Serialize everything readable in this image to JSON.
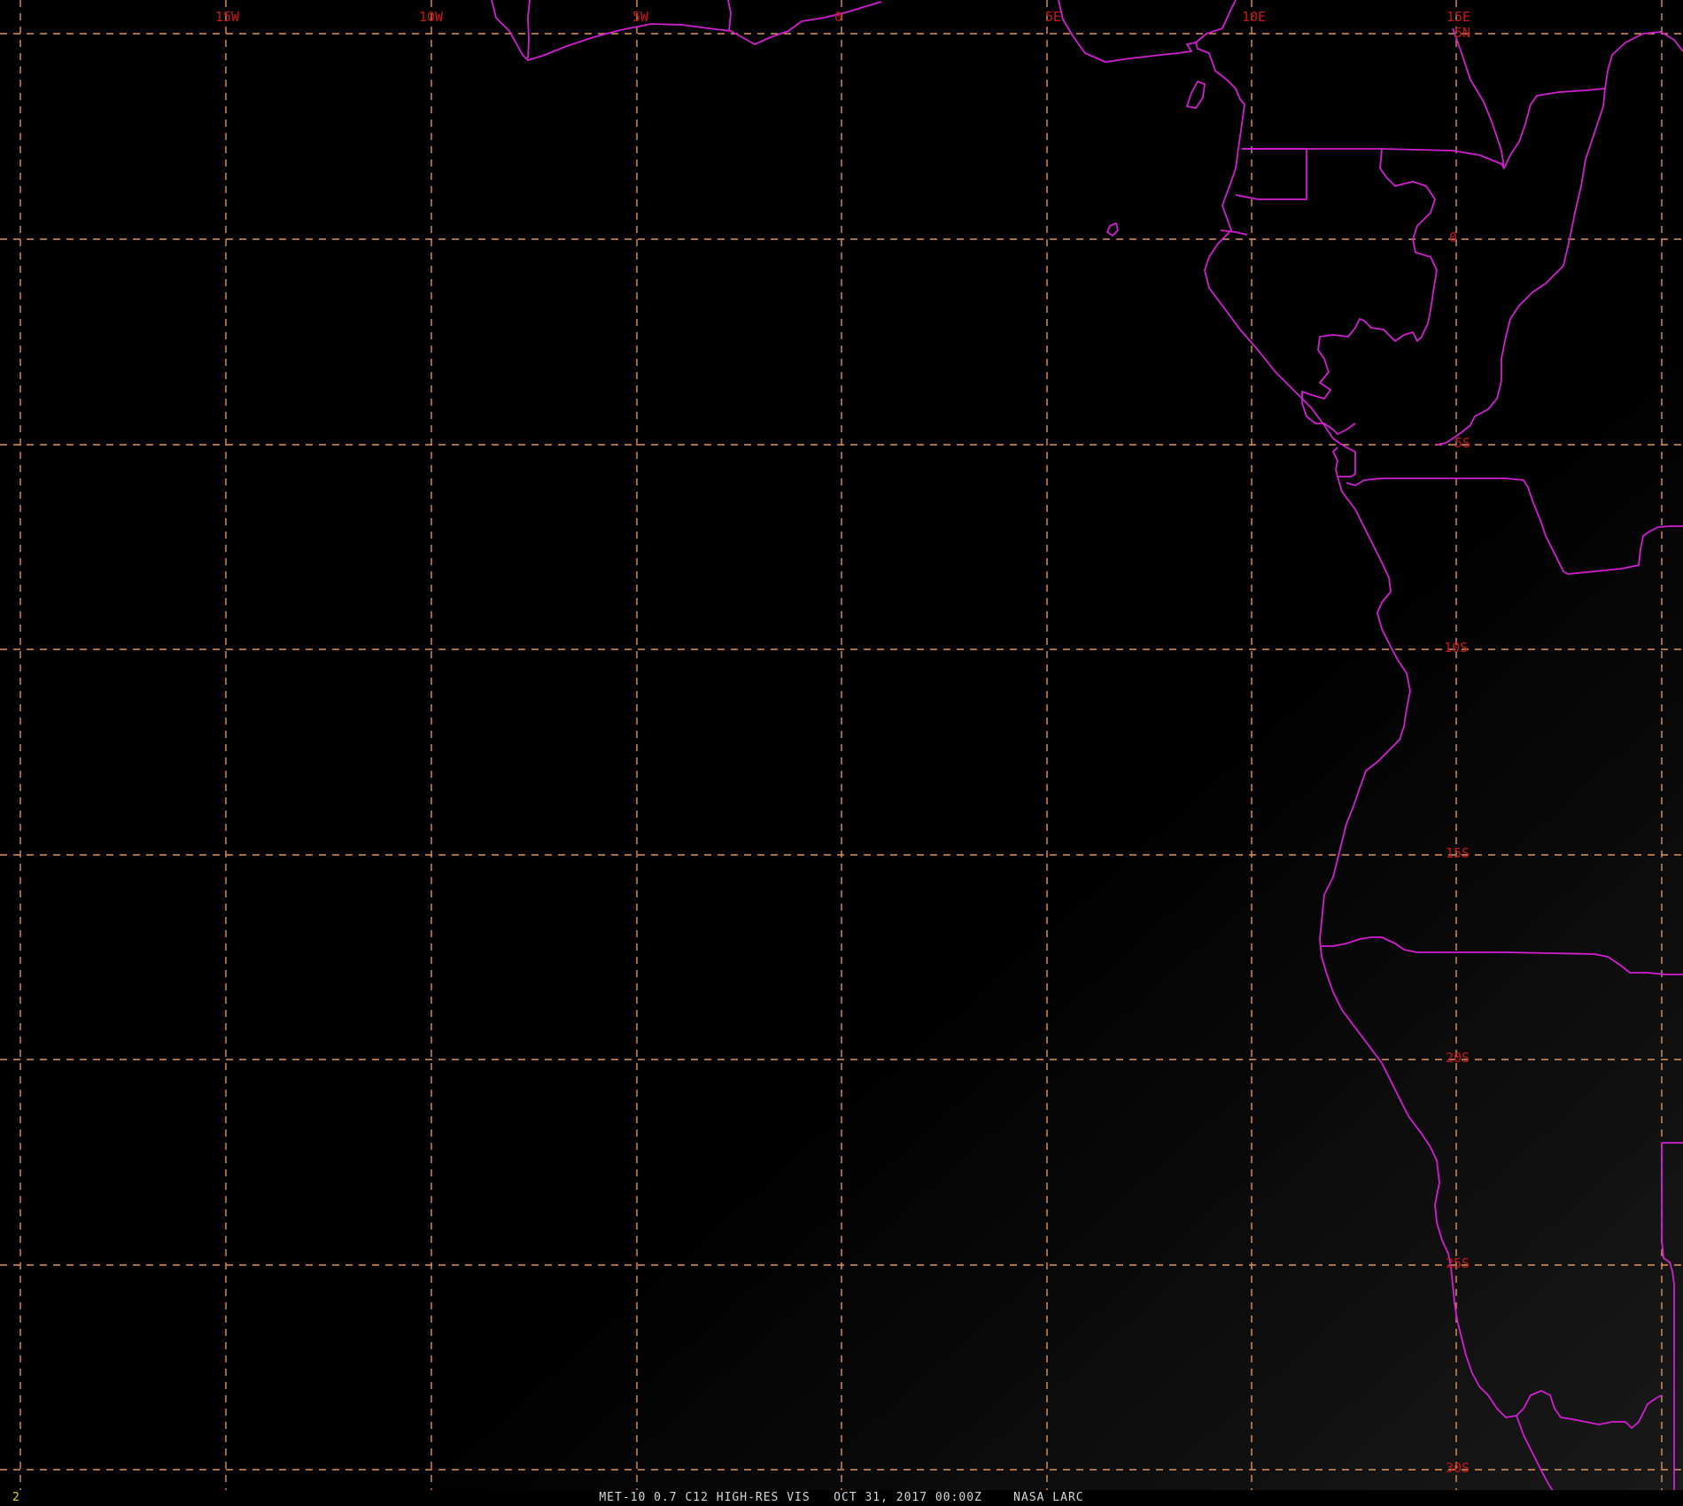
{
  "map": {
    "longitude_labels": [
      "15W",
      "10W",
      "5W",
      "0",
      "5E",
      "10E",
      "15E"
    ],
    "latitude_labels": [
      "5N",
      "0",
      "5S",
      "10S",
      "15S",
      "20S",
      "25S",
      "30S"
    ],
    "colors": {
      "background": "#000000",
      "gridline": "#e0945a",
      "coastline": "#d21fd2",
      "grid_label": "#c81818"
    }
  },
  "footer": {
    "frame_number": "2",
    "caption": "MET-10 0.7 C12 HIGH-RES VIS   OCT 31, 2017 00:00Z    NASA LARC"
  }
}
